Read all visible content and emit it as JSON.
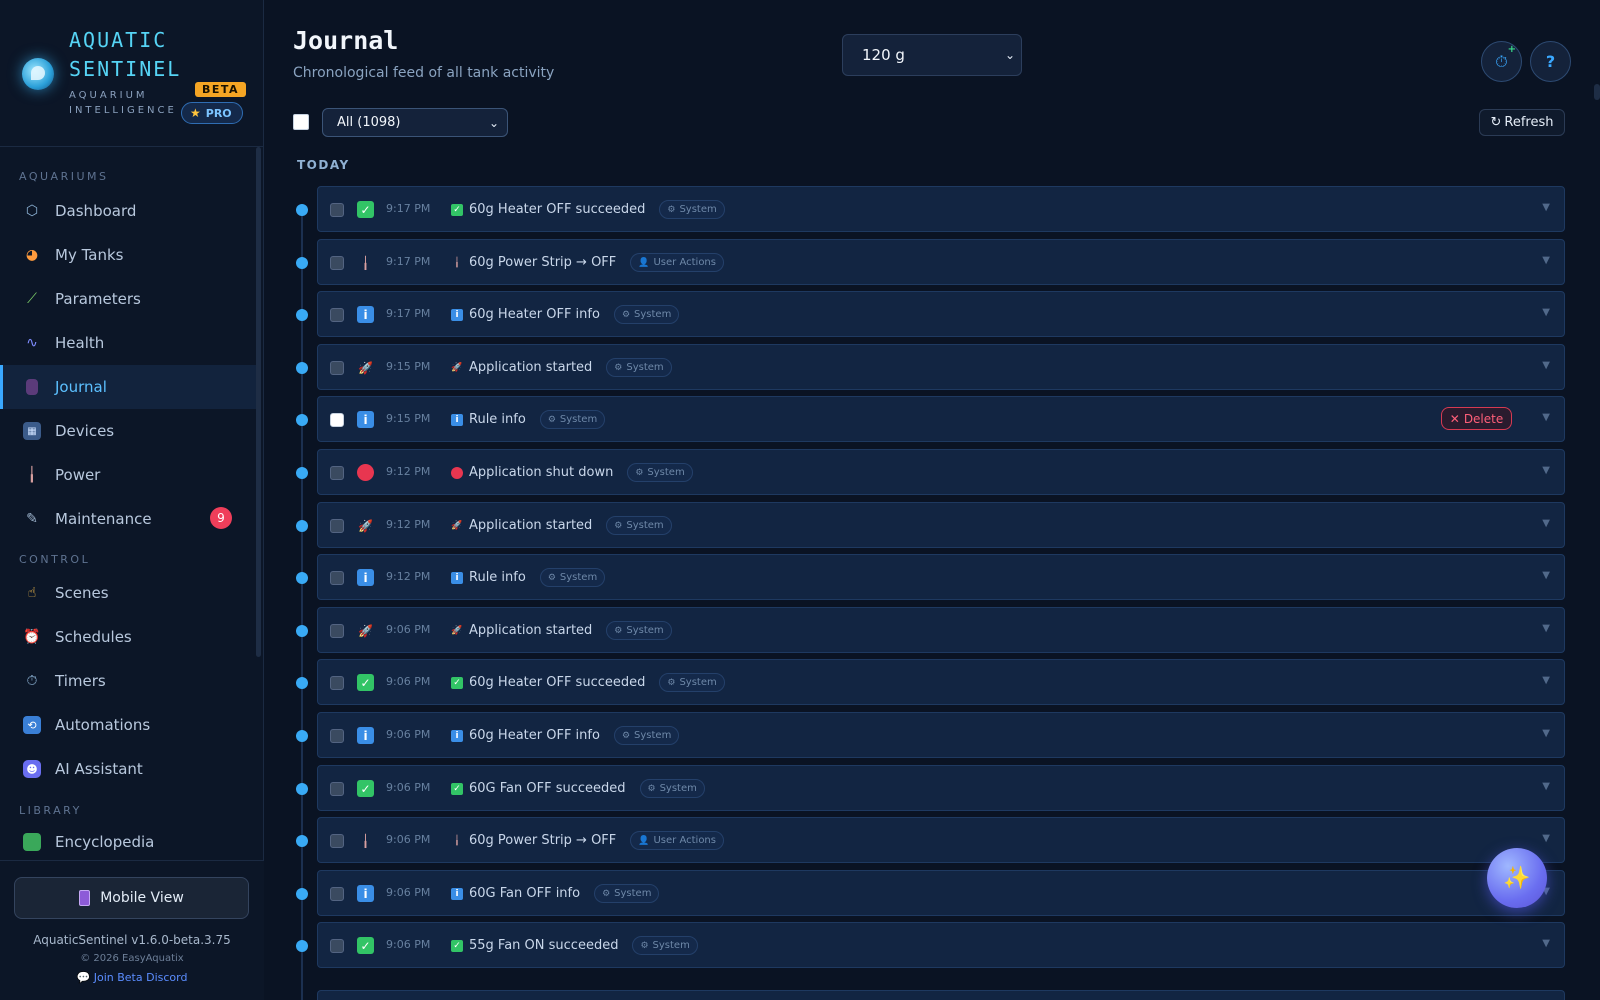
{
  "brand": {
    "name_line1": "AQUATIC",
    "name_line2": "SENTINEL",
    "sub_line1": "AQUARIUM",
    "sub_line2": "INTELLIGENCE",
    "beta": "BETA",
    "pro": "PRO"
  },
  "sidebar": {
    "sections": {
      "aquariums": "AQUARIUMS",
      "control": "CONTROL",
      "library": "LIBRARY"
    },
    "aquarium_items": [
      {
        "label": "Dashboard",
        "icon": "hexagon-icon"
      },
      {
        "label": "My Tanks",
        "icon": "fish-icon"
      },
      {
        "label": "Parameters",
        "icon": "test-tube-icon"
      },
      {
        "label": "Health",
        "icon": "stethoscope-icon"
      },
      {
        "label": "Journal",
        "icon": "notebook-icon",
        "active": true
      },
      {
        "label": "Devices",
        "icon": "devices-icon"
      },
      {
        "label": "Power",
        "icon": "plug-icon"
      },
      {
        "label": "Maintenance",
        "icon": "wrench-icon",
        "badge": "9"
      }
    ],
    "control_items": [
      {
        "label": "Scenes",
        "icon": "hand-icon"
      },
      {
        "label": "Schedules",
        "icon": "alarm-clock-icon"
      },
      {
        "label": "Timers",
        "icon": "stopwatch-icon"
      },
      {
        "label": "Automations",
        "icon": "repeat-icon"
      },
      {
        "label": "AI Assistant",
        "icon": "robot-icon"
      }
    ],
    "library_items": [
      {
        "label": "Encyclopedia",
        "icon": "book-icon"
      }
    ],
    "footer": {
      "mobile_view": "Mobile View",
      "version": "AquaticSentinel v1.6.0-beta.3.75",
      "copyright": "© 2026 EasyAquatix",
      "discord": "Join Beta Discord"
    }
  },
  "header": {
    "title": "Journal",
    "subtitle": "Chronological feed of all tank activity",
    "tank_select": "120 g",
    "filter_select": "All (1098)",
    "refresh": "Refresh"
  },
  "journal": {
    "group_label": "TODAY",
    "delete_label": "Delete",
    "entries": [
      {
        "time": "9:17 PM",
        "title": "60g Heater OFF succeeded",
        "tag": "System",
        "icon": "check"
      },
      {
        "time": "9:17 PM",
        "title": "60g Power Strip → OFF",
        "tag": "User Actions",
        "icon": "plug"
      },
      {
        "time": "9:17 PM",
        "title": "60g Heater OFF info",
        "tag": "System",
        "icon": "info"
      },
      {
        "time": "9:15 PM",
        "title": "Application started",
        "tag": "System",
        "icon": "rocket"
      },
      {
        "time": "9:15 PM",
        "title": "Rule info",
        "tag": "System",
        "icon": "info",
        "hovered": true
      },
      {
        "time": "9:12 PM",
        "title": "Application shut down",
        "tag": "System",
        "icon": "stop"
      },
      {
        "time": "9:12 PM",
        "title": "Application started",
        "tag": "System",
        "icon": "rocket"
      },
      {
        "time": "9:12 PM",
        "title": "Rule info",
        "tag": "System",
        "icon": "info"
      },
      {
        "time": "9:06 PM",
        "title": "Application started",
        "tag": "System",
        "icon": "rocket"
      },
      {
        "time": "9:06 PM",
        "title": "60g Heater OFF succeeded",
        "tag": "System",
        "icon": "check"
      },
      {
        "time": "9:06 PM",
        "title": "60g Heater OFF info",
        "tag": "System",
        "icon": "info"
      },
      {
        "time": "9:06 PM",
        "title": "60G Fan OFF succeeded",
        "tag": "System",
        "icon": "check"
      },
      {
        "time": "9:06 PM",
        "title": "60g Power Strip → OFF",
        "tag": "User Actions",
        "icon": "plug"
      },
      {
        "time": "9:06 PM",
        "title": "60G Fan OFF info",
        "tag": "System",
        "icon": "info"
      },
      {
        "time": "9:06 PM",
        "title": "55g Fan ON succeeded",
        "tag": "System",
        "icon": "check"
      }
    ]
  },
  "colors": {
    "accent": "#3aa8ff",
    "background": "#0a1323",
    "entry_bg": "#122542",
    "danger": "#ff5f79",
    "success": "#32c466"
  }
}
